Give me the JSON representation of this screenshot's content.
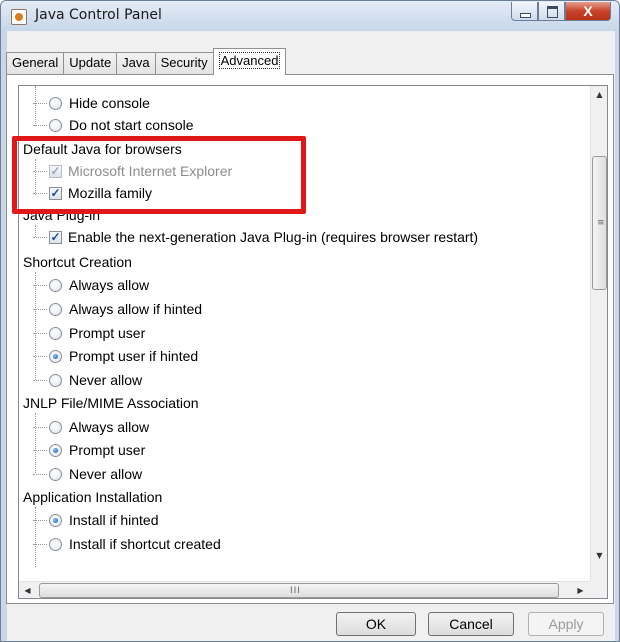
{
  "window": {
    "title": "Java Control Panel",
    "close_label": "X"
  },
  "tabs": [
    {
      "label": "General"
    },
    {
      "label": "Update"
    },
    {
      "label": "Java"
    },
    {
      "label": "Security"
    },
    {
      "label": "Advanced",
      "active": true
    }
  ],
  "tree": {
    "console_items": [
      {
        "label": "Hide console",
        "selected": false
      },
      {
        "label": "Do not start console",
        "selected": false
      }
    ],
    "default_java": {
      "heading": "Default Java for browsers",
      "items": [
        {
          "label": "Microsoft Internet Explorer",
          "checked": true,
          "disabled": true
        },
        {
          "label": "Mozilla family",
          "checked": true,
          "disabled": false
        }
      ]
    },
    "plugin": {
      "heading": "Java Plug-in",
      "items": [
        {
          "label": "Enable the next-generation Java Plug-in (requires browser restart)",
          "checked": true
        }
      ]
    },
    "shortcut": {
      "heading": "Shortcut Creation",
      "items": [
        {
          "label": "Always allow",
          "selected": false
        },
        {
          "label": "Always allow if hinted",
          "selected": false
        },
        {
          "label": "Prompt user",
          "selected": false
        },
        {
          "label": "Prompt user if hinted",
          "selected": true
        },
        {
          "label": "Never allow",
          "selected": false
        }
      ]
    },
    "jnlp": {
      "heading": "JNLP File/MIME Association",
      "items": [
        {
          "label": "Always allow",
          "selected": false
        },
        {
          "label": "Prompt user",
          "selected": true
        },
        {
          "label": "Never allow",
          "selected": false
        }
      ]
    },
    "install": {
      "heading": "Application Installation",
      "items": [
        {
          "label": "Install if hinted",
          "selected": true
        },
        {
          "label": "Install if shortcut created",
          "selected": false
        }
      ]
    }
  },
  "scroll": {
    "h_grip": "III",
    "v_grip": "≡"
  },
  "buttons": {
    "ok": "OK",
    "cancel": "Cancel",
    "apply": "Apply"
  },
  "colors": {
    "highlight": "#e01818",
    "radio_selected": "#1657b8",
    "check_mark": "#1d4b9a"
  }
}
